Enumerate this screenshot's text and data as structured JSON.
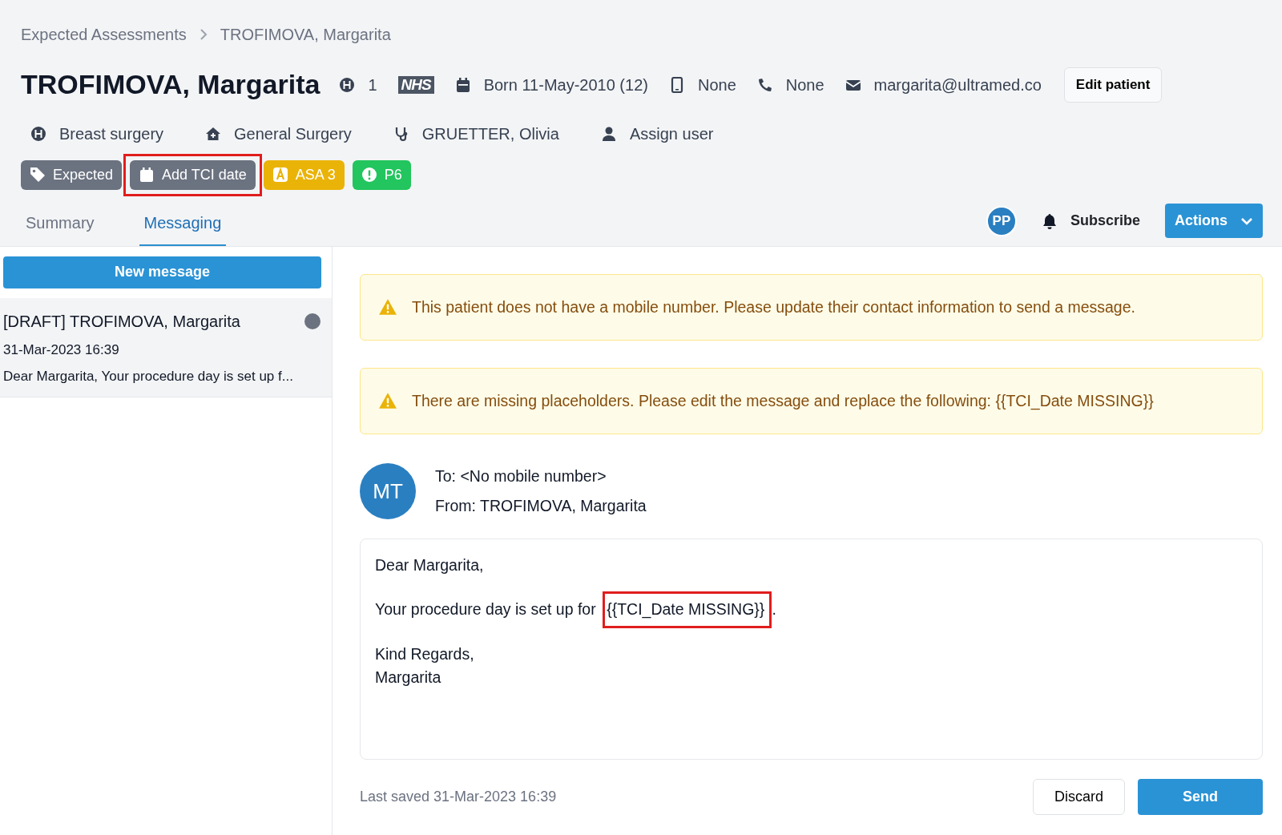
{
  "breadcrumb": [
    "Expected Assessments",
    "TROFIMOVA, Margarita"
  ],
  "patient": {
    "name": "TROFIMOVA, Margarita",
    "hospital_count": "1",
    "nhs": "NHS",
    "born": "Born 11-May-2010 (12)",
    "mobile": "None",
    "phone": "None",
    "email": "margarita@ultramed.co",
    "edit_button": "Edit patient"
  },
  "details": [
    {
      "kind": "hospital",
      "text": "Breast surgery"
    },
    {
      "kind": "home",
      "text": "General Surgery"
    },
    {
      "kind": "doctor",
      "text": "GRUETTER, Olivia"
    },
    {
      "kind": "user",
      "text": "Assign user"
    }
  ],
  "tags": [
    {
      "kind": "tag",
      "text": "Expected",
      "color": "#6b7280",
      "highlighted": false
    },
    {
      "kind": "calendar",
      "text": "Add TCI date",
      "color": "#6b7280",
      "highlighted": true
    },
    {
      "kind": "letter",
      "text": "ASA 3",
      "color": "#eab308",
      "highlighted": false
    },
    {
      "kind": "alert",
      "text": "P6",
      "color": "#22c55e",
      "highlighted": false
    }
  ],
  "tabs": [
    {
      "label": "Summary",
      "selected": false
    },
    {
      "label": "Messaging",
      "selected": true
    }
  ],
  "toolbar": {
    "avatar": "PP",
    "subscribe": "Subscribe",
    "actions": "Actions"
  },
  "new_message": "New message",
  "messages": [
    {
      "title": "[DRAFT] TROFIMOVA, Margarita",
      "date": "31-Mar-2023 16:39",
      "preview": "Dear Margarita, Your procedure day is set up f...",
      "unread": true,
      "selected": true
    }
  ],
  "alerts": [
    {
      "text": "This patient does not have a mobile number. Please update their contact information to send a message."
    },
    {
      "text": "There are missing placeholders. Please edit the message and replace the following: {{TCI_Date MISSING}}"
    }
  ],
  "compose": {
    "avatar": "MT",
    "to": "To: <No mobile number>",
    "from": "From: TROFIMOVA, Margarita",
    "body": [
      {
        "lines": [
          "Dear Margarita,"
        ]
      },
      {
        "lines": [
          "Your procedure day is set up for "
        ],
        "highlight": "{{TCI_Date MISSING}}",
        "after": "."
      },
      {
        "lines": [
          "Kind Regards,",
          "Margarita"
        ]
      }
    ],
    "last_saved": "Last saved 31-Mar-2023 16:39",
    "discard": "Discard",
    "send": "Send"
  }
}
